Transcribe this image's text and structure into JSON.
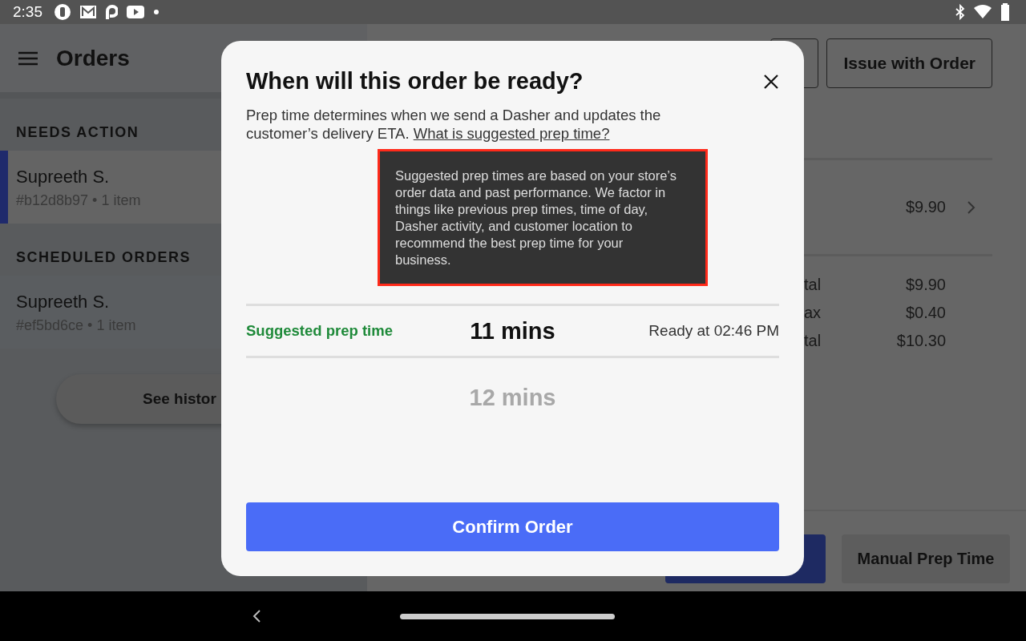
{
  "status_bar": {
    "time": "2:35"
  },
  "sidebar": {
    "title": "Orders",
    "sections": [
      {
        "heading": "NEEDS ACTION",
        "orders": [
          {
            "name": "Supreeth S.",
            "meta": "#b12d8b97 • 1 item",
            "selected": true
          }
        ]
      },
      {
        "heading": "SCHEDULED ORDERS",
        "orders": [
          {
            "name": "Supreeth S.",
            "meta": "#ef5bd6ce • 1 item",
            "selected": false
          }
        ]
      }
    ],
    "history_button": "See histor"
  },
  "order_detail": {
    "issue_button": "Issue with Order",
    "item_price": "$9.90",
    "totals": [
      {
        "label": "tal",
        "amount": "$9.90"
      },
      {
        "label": "ax",
        "amount": "$0.40"
      },
      {
        "label": "tal",
        "amount": "$10.30"
      }
    ],
    "manual_button": "Manual Prep Time"
  },
  "modal": {
    "title": "When will this order be ready?",
    "description": "Prep time determines when we send a Dasher and updates the customer’s delivery ETA.",
    "link": "What is suggested prep time?",
    "tooltip": "Suggested prep times are based on your store’s order data and past performance. We factor in things like previous prep times, time of day, Dasher activity, and customer location to recommend the best prep time for your business.",
    "options": [
      {
        "label": "Suggested prep time",
        "time": "11 mins",
        "ready": "Ready at 02:46 PM",
        "selected": true
      },
      {
        "time": "12 mins",
        "selected": false
      }
    ],
    "confirm": "Confirm Order"
  }
}
